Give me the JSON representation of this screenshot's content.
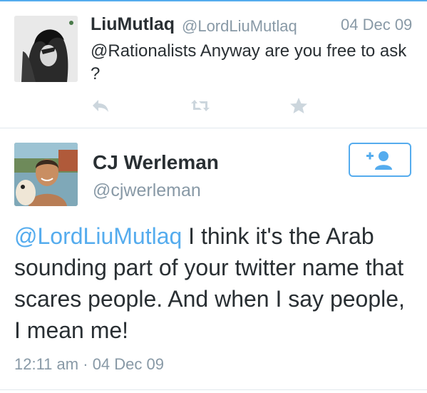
{
  "reply_context_tweet": {
    "author_name": "LiuMutlaq",
    "author_handle": "@LordLiuMutlaq",
    "date": "04 Dec 09",
    "text": "@Rationalists Anyway are you free to ask ?",
    "actions": {
      "reply_icon": "reply-arrow",
      "retweet_icon": "retweet-arrows",
      "favorite_icon": "star"
    }
  },
  "main_tweet": {
    "author_name": "CJ Werleman",
    "author_handle": "@cjwerleman",
    "follow_icon": "add-user",
    "mention": "@LordLiuMutlaq",
    "text": " I think it's the Arab sounding part of your twitter name that scares people. And when I say people, I mean me!",
    "timestamp": "12:11 am",
    "separator": "·",
    "date": "04 Dec 09"
  },
  "colors": {
    "accent": "#55acee",
    "text": "#292f33",
    "muted": "#8899a6",
    "icon": "#ccd6dd",
    "divider": "#e1e8ed"
  }
}
